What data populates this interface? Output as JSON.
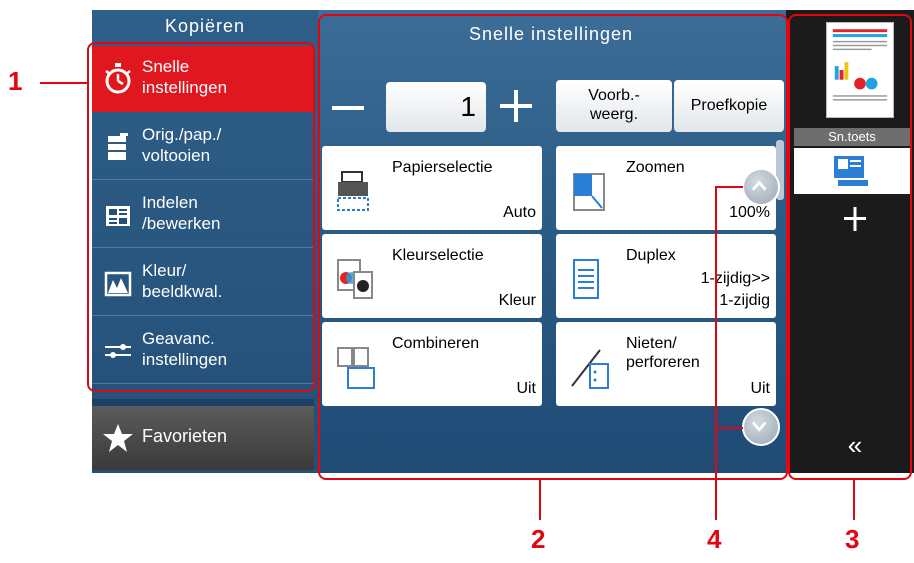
{
  "left_panel": {
    "title": "Kopiëren",
    "items": [
      {
        "label": "Snelle\ninstellingen",
        "icon": "stopwatch-icon",
        "active": true
      },
      {
        "label": "Orig./pap./\nvoltooien",
        "icon": "paper-stack-icon",
        "active": false
      },
      {
        "label": "Indelen\n/bewerken",
        "icon": "layout-icon",
        "active": false
      },
      {
        "label": "Kleur/\nbeeldkwal.",
        "icon": "image-quality-icon",
        "active": false
      },
      {
        "label": "Geavanc.\ninstellingen",
        "icon": "sliders-icon",
        "active": false
      }
    ],
    "favorites_label": "Favorieten"
  },
  "center_panel": {
    "title": "Snelle instellingen",
    "copies_value": "1",
    "preview_label": "Voorb.-\nweerg.",
    "proof_label": "Proefkopie",
    "tiles": [
      {
        "title": "Papierselectie",
        "value": "Auto",
        "icon": "paper-tray-icon"
      },
      {
        "title": "Zoomen",
        "value": "100%",
        "icon": "zoom-icon"
      },
      {
        "title": "Kleurselectie",
        "value": "Kleur",
        "icon": "color-select-icon"
      },
      {
        "title": "Duplex",
        "value": "1-zijdig>>\n1-zijdig",
        "icon": "duplex-icon"
      },
      {
        "title": "Combineren",
        "value": "Uit",
        "icon": "combine-icon"
      },
      {
        "title": "Nieten/\nperforeren",
        "value": "Uit",
        "icon": "staple-icon"
      }
    ]
  },
  "right_panel": {
    "shortcut_label": "Sn.toets",
    "add_icon": "plus-icon",
    "collapse_label": "«"
  },
  "callouts": [
    "1",
    "2",
    "3",
    "4"
  ],
  "colors": {
    "accent_red": "#e20613",
    "active_item": "#e0171f",
    "panel_blue": "#2a5c86"
  }
}
